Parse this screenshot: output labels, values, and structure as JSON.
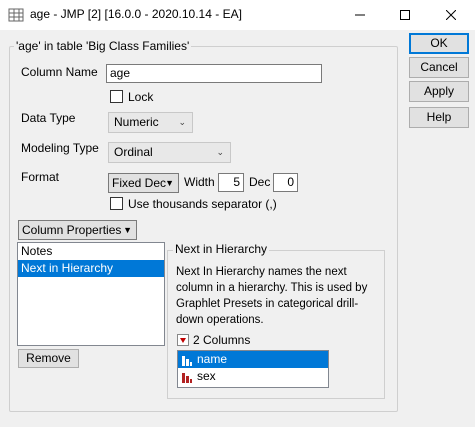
{
  "window": {
    "title": "age - JMP [2] [16.0.0 - 2020.10.14 - EA]",
    "minimize_glyph": "—",
    "maximize_glyph": "☐",
    "close_glyph": "✕"
  },
  "group": {
    "title": "'age' in table 'Big Class Families'"
  },
  "fields": {
    "column_name_label": "Column Name",
    "column_name_value": "age",
    "lock_label": "Lock",
    "data_type_label": "Data Type",
    "data_type_value": "Numeric",
    "modeling_type_label": "Modeling Type",
    "modeling_type_value": "Ordinal",
    "format_label": "Format",
    "format_value": "Fixed Dec",
    "width_label": "Width",
    "width_value": "5",
    "dec_label": "Dec",
    "dec_value": "0",
    "thousands_label": "Use thousands separator (,)"
  },
  "column_properties": {
    "button_label": "Column Properties",
    "items": [
      "Notes",
      "Next in Hierarchy"
    ],
    "selected_index": 1,
    "remove_label": "Remove"
  },
  "hierarchy_panel": {
    "title": "Next in Hierarchy",
    "description": "Next In Hierarchy names the next column in a hierarchy. This is used by Graphlet Presets in categorical drill-down operations.",
    "columns_header": "2 Columns",
    "columns": [
      "name",
      "sex"
    ],
    "selected_column": "name"
  },
  "buttons": {
    "ok": "OK",
    "cancel": "Cancel",
    "apply": "Apply",
    "help": "Help"
  },
  "colors": {
    "selection": "#0078d7",
    "column_icon": "#b22222",
    "disclosure_red": "#c00000"
  }
}
